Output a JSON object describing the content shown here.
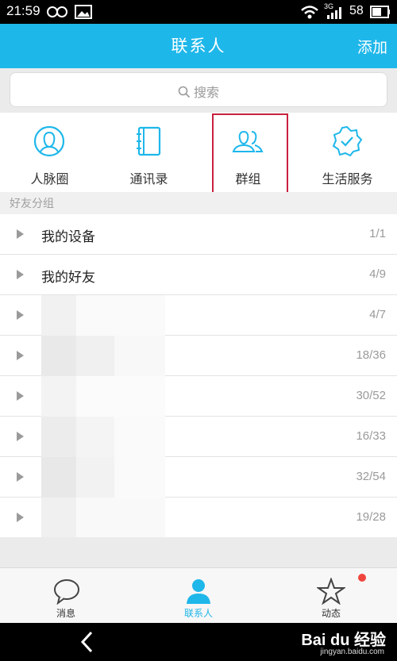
{
  "status_bar": {
    "time": "21:59",
    "network": "3G",
    "battery": "58"
  },
  "header": {
    "title": "联系人",
    "action_label": "添加"
  },
  "search": {
    "placeholder": "搜索"
  },
  "quick_actions": [
    {
      "label": "人脉圈",
      "icon": "person-circle-icon"
    },
    {
      "label": "通讯录",
      "icon": "address-book-icon"
    },
    {
      "label": "群组",
      "icon": "group-icon",
      "highlighted": true
    },
    {
      "label": "生活服务",
      "icon": "service-badge-icon"
    }
  ],
  "section": {
    "label": "好友分组"
  },
  "groups": [
    {
      "name": "我的设备",
      "count": "1/1"
    },
    {
      "name": "我的好友",
      "count": "4/9"
    },
    {
      "name": "",
      "count": "4/7",
      "obscured": true
    },
    {
      "name": "",
      "count": "18/36",
      "obscured": true
    },
    {
      "name": "",
      "count": "30/52",
      "obscured": true
    },
    {
      "name": "",
      "count": "16/33",
      "obscured": true
    },
    {
      "name": "",
      "count": "32/54",
      "obscured": true
    },
    {
      "name": "",
      "count": "19/28",
      "obscured": true
    }
  ],
  "tabs": [
    {
      "label": "消息",
      "icon": "chat-bubble-icon"
    },
    {
      "label": "联系人",
      "icon": "contact-person-icon",
      "active": true
    },
    {
      "label": "动态",
      "icon": "star-icon",
      "badge": true
    }
  ],
  "watermark": {
    "brand": "Bai du 经验",
    "site": "jingyan.baidu.com"
  },
  "colors": {
    "accent": "#1eb7ea",
    "highlight_border": "#c8213f",
    "badge": "#f0453d"
  }
}
